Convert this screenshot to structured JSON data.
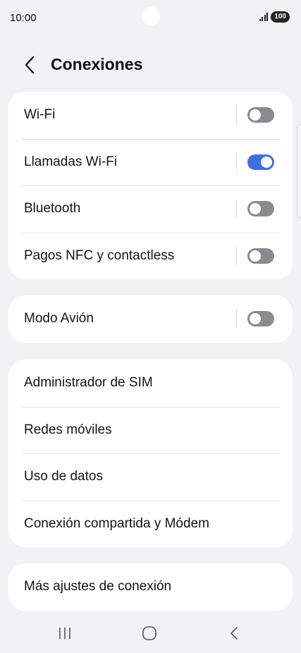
{
  "status_bar": {
    "time": "10:00",
    "battery": "100"
  },
  "header": {
    "title": "Conexiones"
  },
  "groups": [
    {
      "items": [
        {
          "label": "Wi-Fi",
          "toggle": false
        },
        {
          "label": "Llamadas Wi-Fi",
          "toggle": true
        },
        {
          "label": "Bluetooth",
          "toggle": false
        },
        {
          "label": "Pagos NFC y contactless",
          "toggle": false
        }
      ]
    },
    {
      "items": [
        {
          "label": "Modo Avión",
          "toggle": false
        }
      ]
    },
    {
      "items": [
        {
          "label": "Administrador de SIM"
        },
        {
          "label": "Redes móviles"
        },
        {
          "label": "Uso de datos"
        },
        {
          "label": "Conexión compartida y Módem"
        }
      ]
    },
    {
      "items": [
        {
          "label": "Más ajustes de conexión"
        }
      ]
    }
  ],
  "icons": {
    "back": "chevron-left-icon",
    "signal": "signal-icon",
    "nav_recent": "recent-apps-icon",
    "nav_home": "home-icon",
    "nav_back": "back-icon"
  },
  "colors": {
    "background": "#f2f2f5",
    "card": "#ffffff",
    "toggle_on": "#3e6fe0",
    "toggle_off": "#8a8a8f"
  }
}
